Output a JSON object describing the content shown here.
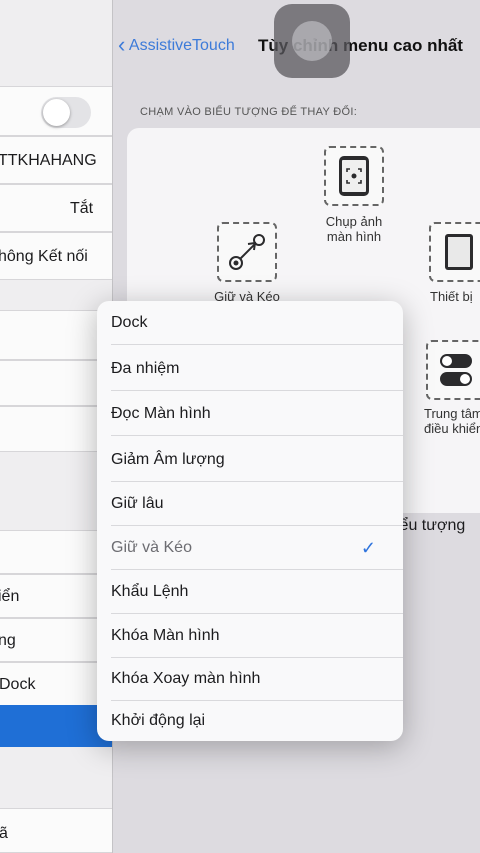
{
  "colors": {
    "accent": "#2f74dd",
    "selected_row": "#1f6fd6"
  },
  "left_pane": {
    "items": [
      {
        "label": "TTKHAHANG"
      },
      {
        "label": "Tắt"
      },
      {
        "label": "hông Kết nối"
      },
      {
        "label": "iển"
      },
      {
        "label": "ng"
      },
      {
        "label": "Dock"
      },
      {
        "label": "ã"
      }
    ],
    "toggle": {
      "state": "off"
    }
  },
  "nav": {
    "back_label": "AssistiveTouch",
    "title": "Tùy chỉnh menu cao nhất"
  },
  "section_header": "CHẠM VÀO BIỂU TƯỢNG ĐỂ THAY ĐỔI:",
  "slots": [
    {
      "icon": "screenshot-icon",
      "label_line1": "Chụp ảnh",
      "label_line2": "màn hình"
    },
    {
      "icon": "hold-drag-icon",
      "label_line1": "Giữ và Kéo",
      "label_line2": ""
    },
    {
      "icon": "device-icon",
      "label_line1": "Thiết bị",
      "label_line2": ""
    },
    {
      "icon": "control-center-icon",
      "label_line1": "Trung tâm",
      "label_line2": "điều khiển"
    }
  ],
  "reset_label": "iểu tượng",
  "dropdown": {
    "options": [
      {
        "label": "Dock",
        "selected": false
      },
      {
        "label": "Đa nhiệm",
        "selected": false
      },
      {
        "label": "Đọc Màn hình",
        "selected": false
      },
      {
        "label": "Giảm Âm lượng",
        "selected": false
      },
      {
        "label": "Giữ lâu",
        "selected": false
      },
      {
        "label": "Giữ và Kéo",
        "selected": true
      },
      {
        "label": "Khẩu Lệnh",
        "selected": false
      },
      {
        "label": "Khóa Màn hình",
        "selected": false
      },
      {
        "label": "Khóa Xoay màn hình",
        "selected": false
      },
      {
        "label": "Khởi động lại",
        "selected": false
      }
    ],
    "check_glyph": "✓"
  }
}
